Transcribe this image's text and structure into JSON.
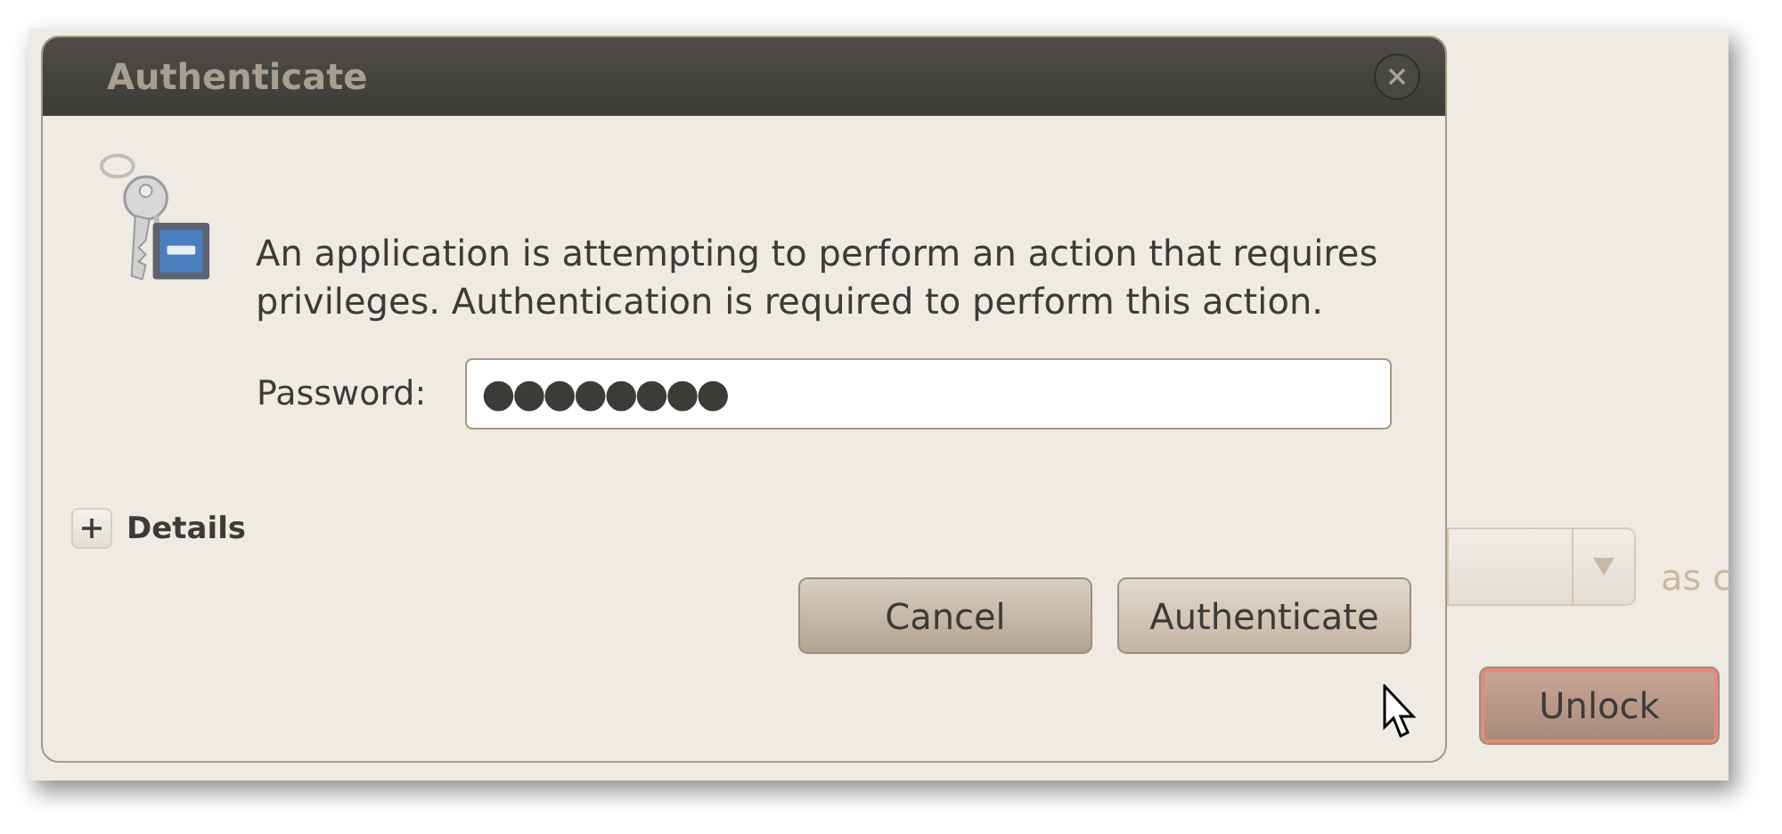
{
  "background_window": {
    "label": "as c",
    "button": "Unlock"
  },
  "dialog": {
    "title": "Authenticate",
    "message": "An application is attempting to perform an action that requires privileges. Authentication is required to perform this action.",
    "password": {
      "label": "Password:",
      "value": "●●●●●●●●"
    },
    "details": {
      "label": "Details",
      "expanded": false
    },
    "buttons": [
      "Cancel",
      "Authenticate"
    ]
  }
}
